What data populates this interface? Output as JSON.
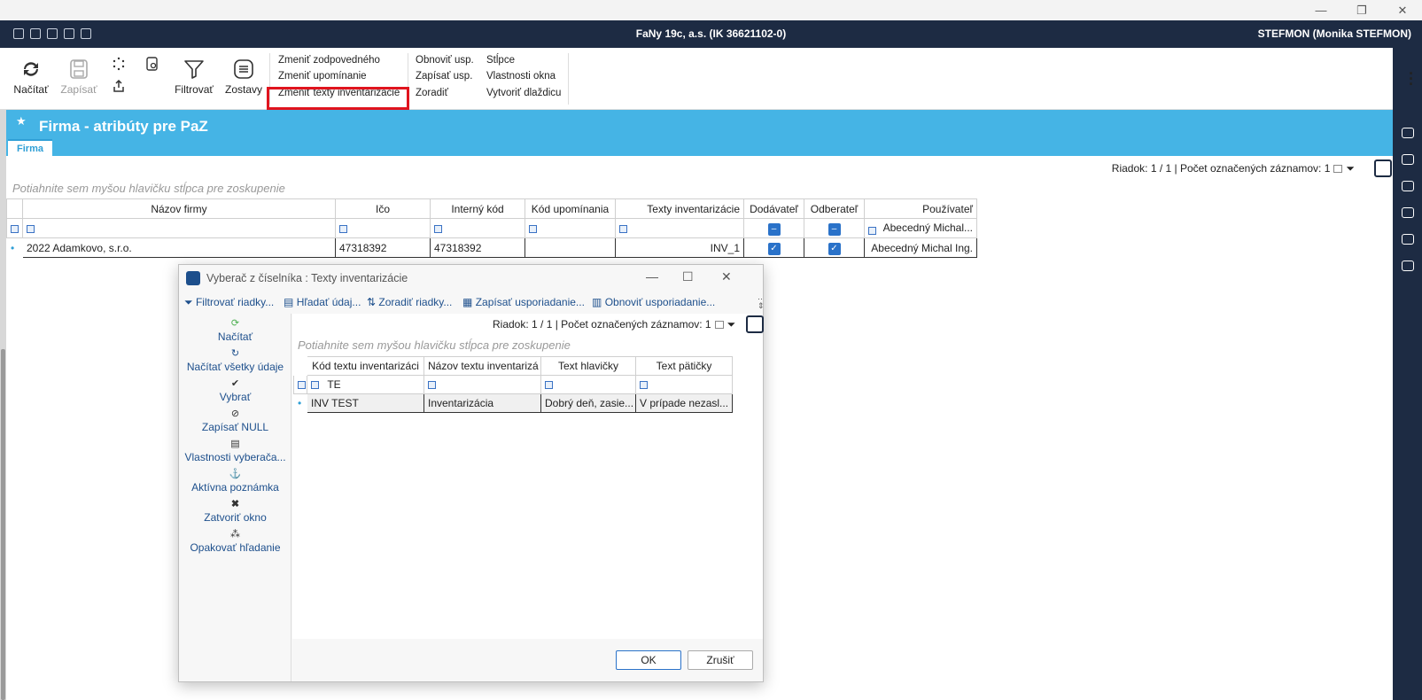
{
  "window": {
    "minimize": "—",
    "maximize": "❐",
    "close": "✕"
  },
  "app": {
    "title": "FaNy 19c, a.s. (IK 36621102-0)",
    "user": "STEFMON (Monika STEFMON)"
  },
  "ribbon": {
    "nacitat": "Načítať",
    "zapisat": "Zapísať",
    "filtrovat": "Filtrovať",
    "zostavy": "Zostavy",
    "col1": [
      "Zmeniť zodpovedného",
      "Zmeniť upomínanie",
      "Zmeniť texty inventarizácie"
    ],
    "col2": [
      "Obnoviť usp.",
      "Zapísať usp.",
      "Zoradiť"
    ],
    "col3": [
      "Stĺpce",
      "Vlastnosti okna",
      "Vytvoriť dlaždicu"
    ]
  },
  "form": {
    "title": "Firma - atribúty pre PaZ",
    "tab": "Firma"
  },
  "grid": {
    "row_info": "Riadok: 1 / 1 | Počet označených záznamov: 1",
    "group_hint": "Potiahnite sem myšou hlavičku stĺpca pre zoskupenie",
    "columns": [
      "Názov firmy",
      "Ičo",
      "Interný kód",
      "Kód upomínania",
      "Texty inventarizácie",
      "Dodávateľ",
      "Odberateľ",
      "Používateľ"
    ],
    "filter_user": "Abecedný Michal...",
    "row": {
      "nazov": "2022 Adamkovo, s.r.o.",
      "ico": "47318392",
      "kod": "47318392",
      "upom": "",
      "texty": "INV_1",
      "user": "Abecedný Michal Ing."
    }
  },
  "dialog": {
    "title": "Vyberač z číselníka : Texty inventarizácie",
    "toolbar": [
      "Filtrovať riadky...",
      "Hľadať údaj...",
      "Zoradiť riadky...",
      "Zapísať usporiadanie...",
      "Obnoviť usporiadanie..."
    ],
    "actions": [
      "Načítať",
      "Načítať všetky údaje",
      "Vybrať",
      "Zapísať NULL",
      "Vlastnosti vyberača...",
      "Aktívna poznámka",
      "Zatvoriť okno",
      "Opakovať hľadanie"
    ],
    "row_info": "Riadok: 1 / 1 | Počet označených záznamov: 1",
    "group_hint": "Potiahnite sem myšou hlavičku stĺpca pre zoskupenie",
    "columns": [
      "Kód textu inventarizáci",
      "Názov textu inventarizá",
      "Text hlavičky",
      "Text pätičky"
    ],
    "filter_kod": "TE",
    "row": {
      "kod": "INV TEST",
      "nazov": "Inventarizácia",
      "hlavicka": "Dobrý deň, zasie...",
      "paticka": "V prípade nezasl..."
    },
    "ok": "OK",
    "cancel": "Zrušiť"
  }
}
